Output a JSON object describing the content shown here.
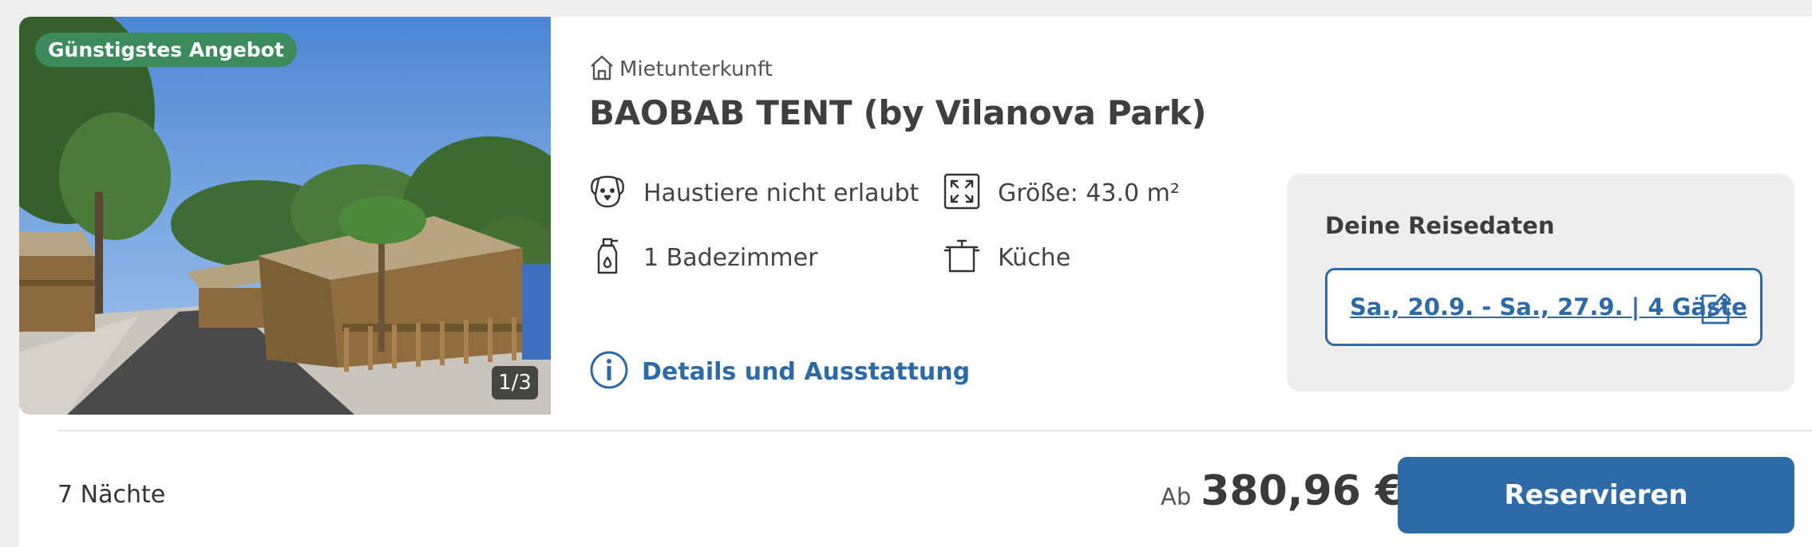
{
  "listing": {
    "badge": "Günstigstes Angebot",
    "photo_counter": "1/3",
    "type_label": "Mietunterkunft",
    "type_icon": "house-icon",
    "title": "BAOBAB TENT (by Vilanova Park)",
    "features": [
      {
        "icon": "dog-icon",
        "label": "Haustiere nicht erlaubt"
      },
      {
        "icon": "expand-arrows-icon",
        "label": "Größe: 43.0 m²"
      },
      {
        "icon": "soap-bottle-icon",
        "label": "1 Badezimmer"
      },
      {
        "icon": "cooking-pot-icon",
        "label": "Küche"
      }
    ],
    "details_link": "Details und Ausstattung"
  },
  "travel": {
    "label": "Deine Reisedaten",
    "dates": "Sa., 20.9. - Sa., 27.9. | 4 Gäste"
  },
  "footer": {
    "nights": "7 Nächte",
    "price_prefix": "Ab",
    "price": "380,96 €",
    "reserve_label": "Reservieren"
  },
  "colors": {
    "accent": "#2e6aa6",
    "badge": "#3d8a5c",
    "background": "#efefef"
  }
}
